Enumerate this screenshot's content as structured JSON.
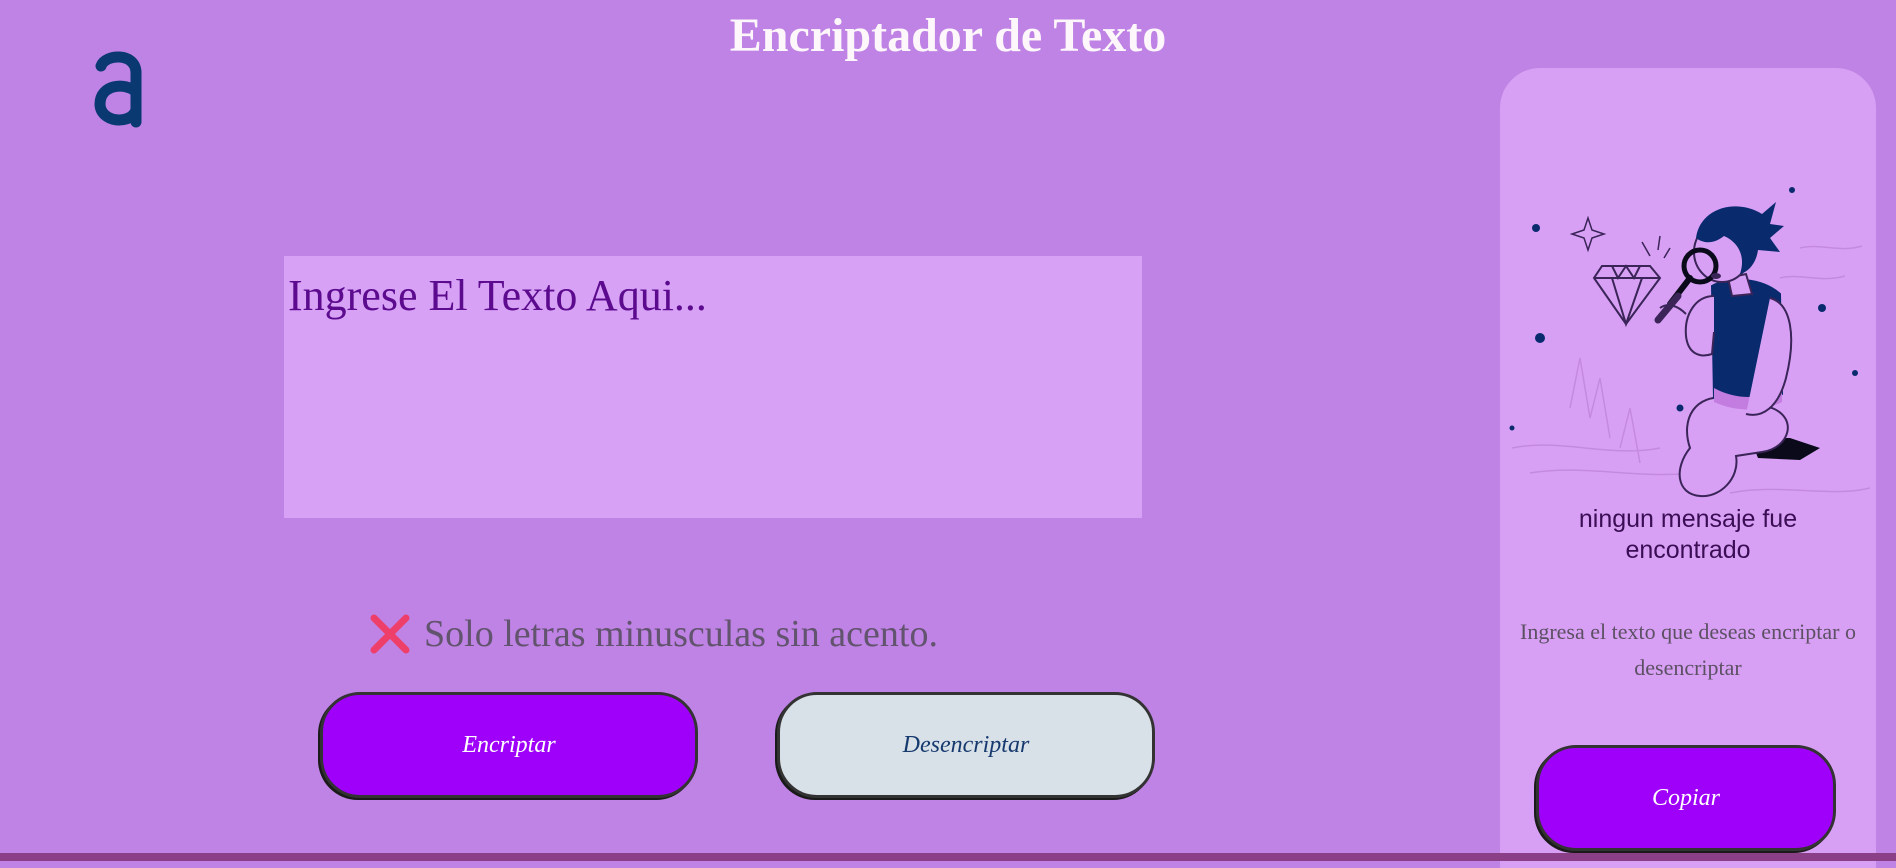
{
  "header": {
    "title": "Encriptador de Texto",
    "logo_icon": "alura-logo-icon"
  },
  "editor": {
    "placeholder": "Ingrese El Texto Aqui...",
    "value": ""
  },
  "warning": {
    "icon": "cross-mark-icon",
    "text": "Solo letras minusculas sin acento."
  },
  "actions": {
    "encrypt_label": "Encriptar",
    "decrypt_label": "Desencriptar"
  },
  "output_panel": {
    "illustration": "person-with-magnifying-glass-icon",
    "title": "ningun mensaje fue encontrado",
    "description": "Ingresa el texto que deseas encriptar o desencriptar",
    "copy_label": "Copiar"
  },
  "colors": {
    "background": "#bf83e5",
    "panel": "#d8a0f5",
    "primary_button": "#9f00fa",
    "secondary_button": "#d8e0e8",
    "logo": "#0a3871",
    "warning_icon": "#ee3f6b"
  }
}
